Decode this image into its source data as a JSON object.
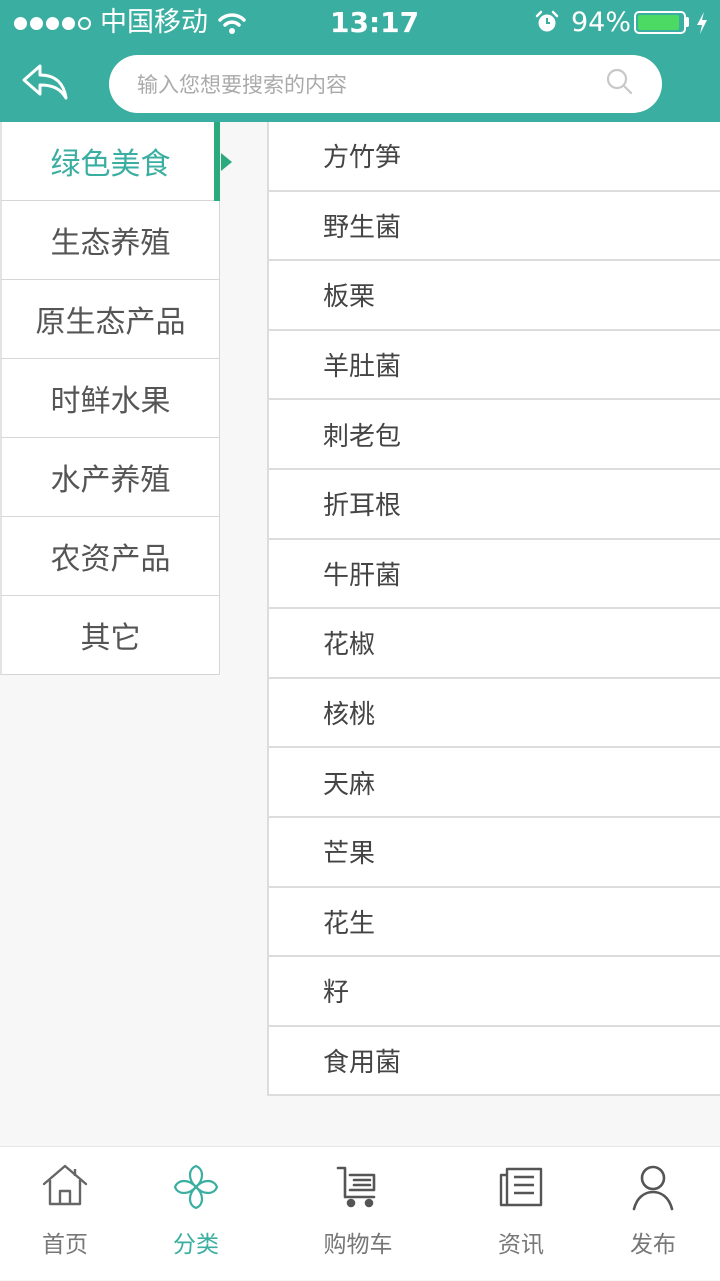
{
  "status_bar": {
    "carrier": "中国移动",
    "time": "13:17",
    "battery": "94%",
    "battery_level": 0.94
  },
  "search": {
    "placeholder": "输入您想要搜索的内容",
    "value": ""
  },
  "categories": [
    {
      "label": "绿色美食",
      "active": true
    },
    {
      "label": "生态养殖",
      "active": false
    },
    {
      "label": "原生态产品",
      "active": false
    },
    {
      "label": "时鲜水果",
      "active": false
    },
    {
      "label": "水产养殖",
      "active": false
    },
    {
      "label": "农资产品",
      "active": false
    },
    {
      "label": "其它",
      "active": false
    }
  ],
  "items": [
    "方竹笋",
    "野生菌",
    "板栗",
    "羊肚菌",
    "刺老包",
    "折耳根",
    "牛肝菌",
    "花椒",
    "核桃",
    "天麻",
    "芒果",
    "花生",
    "籽",
    "食用菌"
  ],
  "tabbar": [
    {
      "label": "首页",
      "icon": "home-icon",
      "active": false
    },
    {
      "label": "分类",
      "icon": "clover-icon",
      "active": true
    },
    {
      "label": "购物车",
      "icon": "cart-icon",
      "active": false
    },
    {
      "label": "资讯",
      "icon": "news-icon",
      "active": false
    },
    {
      "label": "发布",
      "icon": "user-icon",
      "active": false
    }
  ],
  "colors": {
    "accent": "#3aaea0",
    "active_marker": "#2baa7e",
    "battery_fill": "#4cd964"
  }
}
